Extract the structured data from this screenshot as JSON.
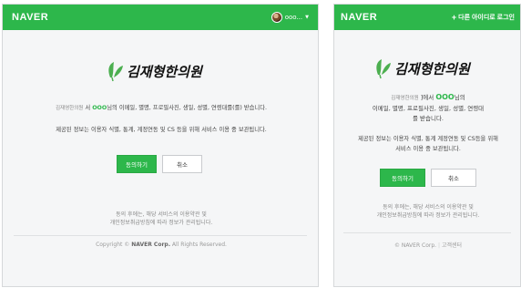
{
  "desktop": {
    "logo": "NAVER",
    "username": "ooo...",
    "clinic_label": "김재형한의원",
    "consent_prefix": "김재영한의원",
    "consent_line1_a": "서",
    "consent_name": "OOO",
    "consent_line1_b": "님의 이메일, 별명, 프로필사진, 생일, 성별, 연령대를(를) 받습니다.",
    "consent_line2": "제공된 정보는 이용자 식별, 통계, 계정연동 및 CS 등을 위해 서비스 이용 중 보관됩니다.",
    "agree_label": "동의하기",
    "cancel_label": "취소",
    "notice_line1": "동의 후에는, 해당 서비스의 이용약관 및",
    "notice_line2": "개인정보취급방침에 따라 정보가 관리됩니다.",
    "copyright_prefix": "Copyright ©",
    "copyright_brand": "NAVER Corp.",
    "copyright_suffix": "All Rights Reserved."
  },
  "mobile": {
    "logo": "NAVER",
    "switch_label": "다른 아이디로 로그인",
    "clinic_label": "김재형한의원",
    "consent_prefix": "김재영한의원",
    "consent_line1_a": "]에서",
    "consent_name": "OOO",
    "consent_line1_b": "님의",
    "consent_line2": "이메일, 별명, 프로필사진, 생일, 성별, 연령대",
    "consent_line3": "를 받습니다.",
    "consent_line4": "제공된 정보는 이용자 식별, 통계 계정연동 및 CS등을 위해",
    "consent_line5": "서비스 이용 중 보관됩니다.",
    "agree_label": "동의하기",
    "cancel_label": "취소",
    "notice_line1": "동의 후에는, 해당 서비스의 이용약관 및",
    "notice_line2": "개인정보취급방침에 따라 정보가 관리됩니다.",
    "footer_brand": "© NAVER Corp.",
    "footer_link": "고객센터"
  },
  "colors": {
    "naver_green": "#2db74b",
    "logo_green": "#4caf50",
    "ink": "#111111"
  },
  "icons": {
    "plus": "plus-icon",
    "caret": "caret-down-icon",
    "avatar": "avatar"
  }
}
